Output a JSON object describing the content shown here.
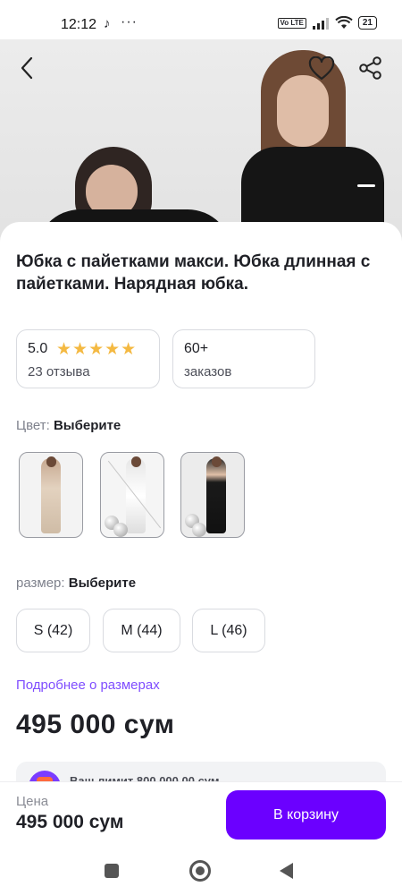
{
  "status_bar": {
    "time": "12:12",
    "tiktok_icon": "♪",
    "dots": "···",
    "volte": "Vo LTE",
    "battery": "21"
  },
  "header": {
    "back_icon": "chevron-left-icon",
    "favorite_icon": "heart-icon",
    "share_icon": "share-icon"
  },
  "product": {
    "title": "Юбка с пайетками макси. Юбка длинная с пайетками. Нарядная юбка.",
    "rating": "5.0",
    "stars": "★★★★★",
    "reviews": "23 отзыва",
    "orders_count": "60+",
    "orders_label": "заказов",
    "color_label": "Цвет:",
    "color_value": "Выберите",
    "color_variants": [
      "gold sequin",
      "white sequin",
      "black sequin"
    ],
    "size_label": "размер:",
    "size_value": "Выберите",
    "sizes": [
      "S (42)",
      "M (44)",
      "L (46)"
    ],
    "size_info_link": "Подробнее о размерах",
    "price": "495 000 сум",
    "promo_text": "Ваш лимит 800 000,00 сум"
  },
  "bottom_bar": {
    "price_caption": "Цена",
    "price": "495 000 сум",
    "cart_button": "В корзину"
  },
  "colors": {
    "accent": "#6b00ff",
    "link": "#7f4dff",
    "stars": "#f4b942",
    "text": "#1f2026"
  }
}
